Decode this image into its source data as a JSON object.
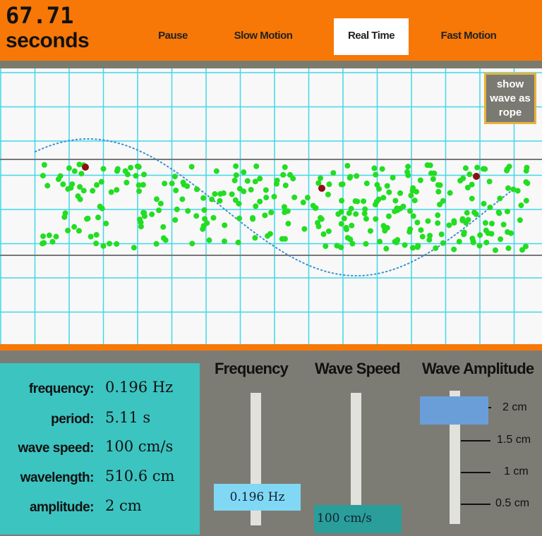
{
  "timer": {
    "value": "67.71",
    "unit": "seconds"
  },
  "modes": [
    {
      "label": "Pause",
      "active": false
    },
    {
      "label": "Slow Motion",
      "active": false
    },
    {
      "label": "Real Time",
      "active": true
    },
    {
      "label": "Fast Motion",
      "active": false
    }
  ],
  "rope_button": {
    "label": "show wave as rope"
  },
  "info": {
    "frequency": {
      "label": "frequency:",
      "value": "0.196 Hz"
    },
    "period": {
      "label": "period:",
      "value": "5.11 s"
    },
    "wave_speed": {
      "label": "wave speed:",
      "value": "100 cm/s"
    },
    "wavelength": {
      "label": "wavelength:",
      "value": "510.6 cm"
    },
    "amplitude": {
      "label": "amplitude:",
      "value": "2 cm"
    }
  },
  "controls": {
    "frequency": {
      "title": "Frequency",
      "value": "0.196 Hz"
    },
    "wave_speed": {
      "title": "Wave Speed",
      "value": "100 cm/s"
    },
    "amplitude": {
      "title": "Wave Amplitude",
      "ticks": [
        "2 cm",
        "1.5 cm",
        "1 cm",
        "0.5 cm"
      ],
      "selected": "2 cm"
    }
  },
  "colors": {
    "accent": "#f77806",
    "grid": "#40d8e8",
    "particle": "#22dd22",
    "marked_particle": "#8b1010",
    "info_bg": "#3cc4c1",
    "panel_bg": "#7d7c74",
    "freq_tag": "#80d8f5",
    "speed_tag": "#2a9e9a",
    "amp_handle": "#6a9ed8"
  }
}
